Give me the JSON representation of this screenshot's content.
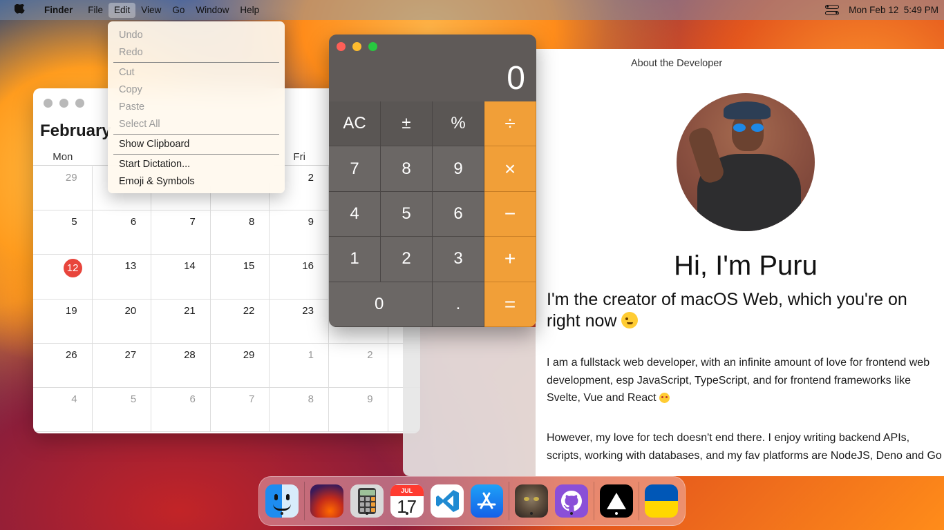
{
  "menubar": {
    "app_name": "Finder",
    "menus": [
      "File",
      "Edit",
      "View",
      "Go",
      "Window",
      "Help"
    ],
    "active_menu": "Edit",
    "datetime": "Mon Feb 12  5:49 PM"
  },
  "edit_menu": {
    "items": [
      {
        "label": "Undo",
        "enabled": false
      },
      {
        "label": "Redo",
        "enabled": false
      },
      {
        "label": "Cut",
        "enabled": false
      },
      {
        "label": "Copy",
        "enabled": false
      },
      {
        "label": "Paste",
        "enabled": false
      },
      {
        "label": "Select All",
        "enabled": false
      },
      {
        "label": "Show Clipboard",
        "enabled": true
      },
      {
        "label": "Start Dictation...",
        "enabled": true
      },
      {
        "label": "Emoji & Symbols",
        "enabled": true
      }
    ]
  },
  "calendar": {
    "month_label": "February",
    "weekdays": [
      "Mon",
      "",
      "",
      "",
      "Fri",
      ""
    ],
    "today": "12",
    "rows": [
      [
        "29",
        "",
        "",
        "",
        "2",
        ""
      ],
      [
        "5",
        "6",
        "7",
        "8",
        "9",
        ""
      ],
      [
        "12",
        "13",
        "14",
        "15",
        "16",
        ""
      ],
      [
        "19",
        "20",
        "21",
        "22",
        "23",
        ""
      ],
      [
        "26",
        "27",
        "28",
        "29",
        "1",
        "2"
      ],
      [
        "4",
        "5",
        "6",
        "7",
        "8",
        "9"
      ]
    ],
    "dim_rows": {
      "0": [
        0
      ],
      "4": [
        4,
        5
      ],
      "5": [
        0,
        1,
        2,
        3,
        4,
        5
      ]
    }
  },
  "calculator": {
    "display": "0",
    "keys": [
      {
        "label": "AC",
        "kind": "func"
      },
      {
        "label": "±",
        "kind": "func"
      },
      {
        "label": "%",
        "kind": "func"
      },
      {
        "label": "÷",
        "kind": "op"
      },
      {
        "label": "7",
        "kind": "num"
      },
      {
        "label": "8",
        "kind": "num"
      },
      {
        "label": "9",
        "kind": "num"
      },
      {
        "label": "×",
        "kind": "op"
      },
      {
        "label": "4",
        "kind": "num"
      },
      {
        "label": "5",
        "kind": "num"
      },
      {
        "label": "6",
        "kind": "num"
      },
      {
        "label": "−",
        "kind": "op"
      },
      {
        "label": "1",
        "kind": "num"
      },
      {
        "label": "2",
        "kind": "num"
      },
      {
        "label": "3",
        "kind": "num"
      },
      {
        "label": "+",
        "kind": "op"
      },
      {
        "label": "0",
        "kind": "zero"
      },
      {
        "label": ".",
        "kind": "num"
      },
      {
        "label": "=",
        "kind": "op"
      }
    ]
  },
  "about": {
    "window_title": "About the Developer",
    "heading": "Hi, I'm Puru",
    "subheading": "I'm the creator of macOS Web, which you're on right now",
    "paragraph1": "I am a fullstack web developer, with an infinite amount of love for frontend web development, esp JavaScript, TypeScript, and for frontend frameworks like Svelte, Vue and React",
    "paragraph2": "However, my love for tech doesn't end there. I enjoy writing backend APIs, scripts, working with databases, and my fav platforms are NodeJS, Deno and Go"
  },
  "dock": {
    "calendar_month": "JUL",
    "calendar_day": "17",
    "apps": [
      {
        "icon": "finder-icon",
        "running": true
      },
      {
        "icon": "wallpapers-icon",
        "running": false
      },
      {
        "icon": "calculator-icon",
        "running": true
      },
      {
        "icon": "calendar-icon",
        "running": true
      },
      {
        "icon": "vscode-icon",
        "running": false
      },
      {
        "icon": "app-store-icon",
        "running": false
      },
      {
        "icon": "purrfect-cat-icon",
        "running": true
      },
      {
        "icon": "github-icon",
        "running": true
      },
      {
        "icon": "vercel-icon",
        "running": true
      },
      {
        "icon": "ukraine-flag-icon",
        "running": true
      }
    ]
  },
  "colors": {
    "accent_orange": "#f19f38",
    "today_red": "#e8453c",
    "close": "#fe5f57",
    "minimize": "#febc2e",
    "maximize": "#28c840"
  }
}
